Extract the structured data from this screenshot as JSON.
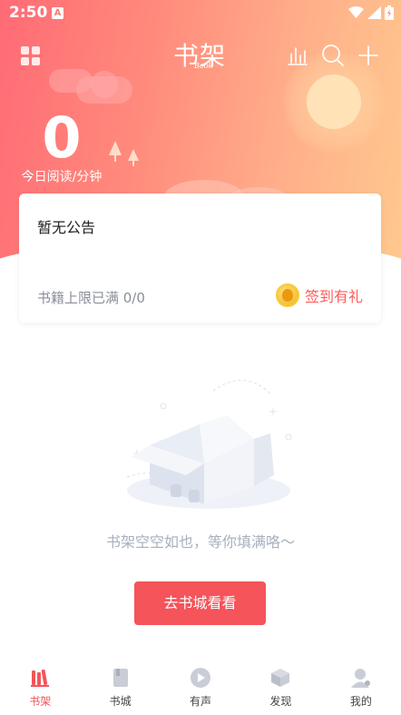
{
  "status_bar": {
    "time": "2:50",
    "notification_icon": "A"
  },
  "header": {
    "title": "书架",
    "subtitle": "Book"
  },
  "reading_stats": {
    "minutes": "0",
    "label": "今日阅读/分钟"
  },
  "notice_card": {
    "notice": "暂无公告",
    "book_limit": "书籍上限已满 0/0",
    "checkin_label": "签到有礼"
  },
  "empty_state": {
    "message": "书架空空如也，等你填满咯～",
    "button_label": "去书城看看"
  },
  "tabs": [
    {
      "label": "书架",
      "icon": "bookshelf-icon",
      "active": true
    },
    {
      "label": "书城",
      "icon": "bookstore-icon",
      "active": false
    },
    {
      "label": "有声",
      "icon": "play-icon",
      "active": false
    },
    {
      "label": "发现",
      "icon": "cube-icon",
      "active": false
    },
    {
      "label": "我的",
      "icon": "user-icon",
      "active": false
    }
  ],
  "colors": {
    "accent": "#f4545a",
    "hero_start": "#ff6b75",
    "hero_end": "#ffc98f"
  }
}
